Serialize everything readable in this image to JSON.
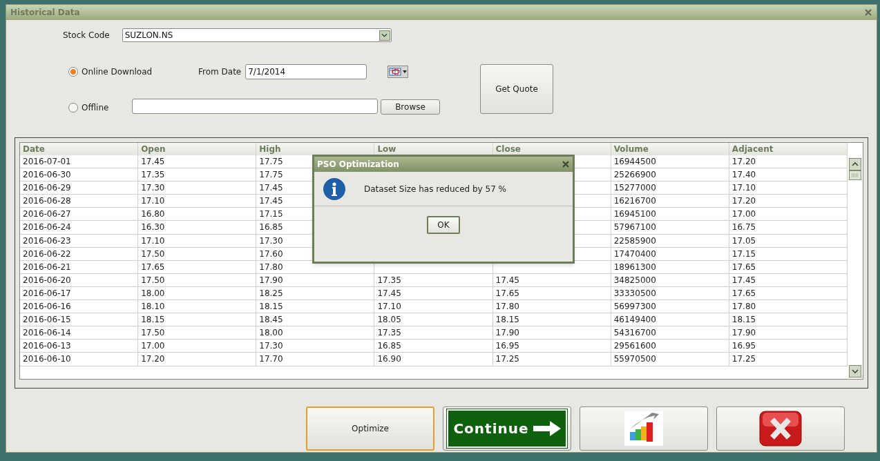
{
  "window": {
    "title": "Historical Data"
  },
  "stock_code": {
    "label": "Stock Code",
    "value": "SUZLON.NS"
  },
  "source_options": [
    {
      "label": "Online Download",
      "selected": true
    },
    {
      "label": "Offline",
      "selected": false
    }
  ],
  "from_date": {
    "label": "From Date",
    "value": "7/1/2014"
  },
  "browse_button": "Browse",
  "get_quote_button": "Get Quote",
  "table": {
    "columns": [
      "Date",
      "Open",
      "High",
      "Low",
      "Close",
      "Volume",
      "Adjacent"
    ],
    "rows": [
      {
        "date": "2016-07-01",
        "open": "17.45",
        "high": "17.75",
        "volume": "16944500",
        "adjacent": "17.20"
      },
      {
        "date": "2016-06-30",
        "open": "17.35",
        "high": "17.75",
        "volume": "25266900",
        "adjacent": "17.40"
      },
      {
        "date": "2016-06-29",
        "open": "17.30",
        "high": "17.45",
        "volume": "15277000",
        "adjacent": "17.10"
      },
      {
        "date": "2016-06-28",
        "open": "17.10",
        "high": "17.45",
        "volume": "16216700",
        "adjacent": "17.20"
      },
      {
        "date": "2016-06-27",
        "open": "16.80",
        "high": "17.15",
        "volume": "16945100",
        "adjacent": "17.00"
      },
      {
        "date": "2016-06-24",
        "open": "16.30",
        "high": "16.85",
        "volume": "57967100",
        "adjacent": "16.75"
      },
      {
        "date": "2016-06-23",
        "open": "17.10",
        "high": "17.30",
        "volume": "22585900",
        "adjacent": "17.05"
      },
      {
        "date": "2016-06-22",
        "open": "17.50",
        "high": "17.60",
        "volume": "17470400",
        "adjacent": "17.15"
      },
      {
        "date": "2016-06-21",
        "open": "17.65",
        "high": "17.80",
        "volume": "18961300",
        "adjacent": "17.65"
      },
      {
        "date": "2016-06-20",
        "open": "17.50",
        "high": "17.90",
        "low": "17.35",
        "close": "17.45",
        "volume": "34825000",
        "adjacent": "17.45"
      },
      {
        "date": "2016-06-17",
        "open": "18.00",
        "high": "18.25",
        "low": "17.45",
        "close": "17.65",
        "volume": "33330500",
        "adjacent": "17.65"
      },
      {
        "date": "2016-06-16",
        "open": "18.10",
        "high": "18.15",
        "low": "17.10",
        "close": "17.80",
        "volume": "56997300",
        "adjacent": "17.80"
      },
      {
        "date": "2016-06-15",
        "open": "18.15",
        "high": "18.45",
        "low": "18.05",
        "close": "18.15",
        "volume": "46149400",
        "adjacent": "18.15"
      },
      {
        "date": "2016-06-14",
        "open": "17.50",
        "high": "18.00",
        "low": "17.35",
        "close": "17.90",
        "volume": "54316700",
        "adjacent": "17.90"
      },
      {
        "date": "2016-06-13",
        "open": "17.00",
        "high": "17.30",
        "low": "16.85",
        "close": "16.95",
        "volume": "29561600",
        "adjacent": "16.95"
      },
      {
        "date": "2016-06-10",
        "open": "17.20",
        "high": "17.70",
        "low": "16.90",
        "close": "17.25",
        "volume": "55970500",
        "adjacent": "17.25"
      }
    ]
  },
  "dialog": {
    "title": "PSO Optimization",
    "message": "Dataset Size has reduced by 57 %",
    "ok_button": "OK"
  },
  "bottom_buttons": [
    {
      "kind": "text",
      "label": "Optimize",
      "focused": true
    },
    {
      "kind": "sign",
      "label": "Continue",
      "focused": false
    },
    {
      "kind": "chart",
      "focused": false
    },
    {
      "kind": "close",
      "focused": false
    }
  ]
}
